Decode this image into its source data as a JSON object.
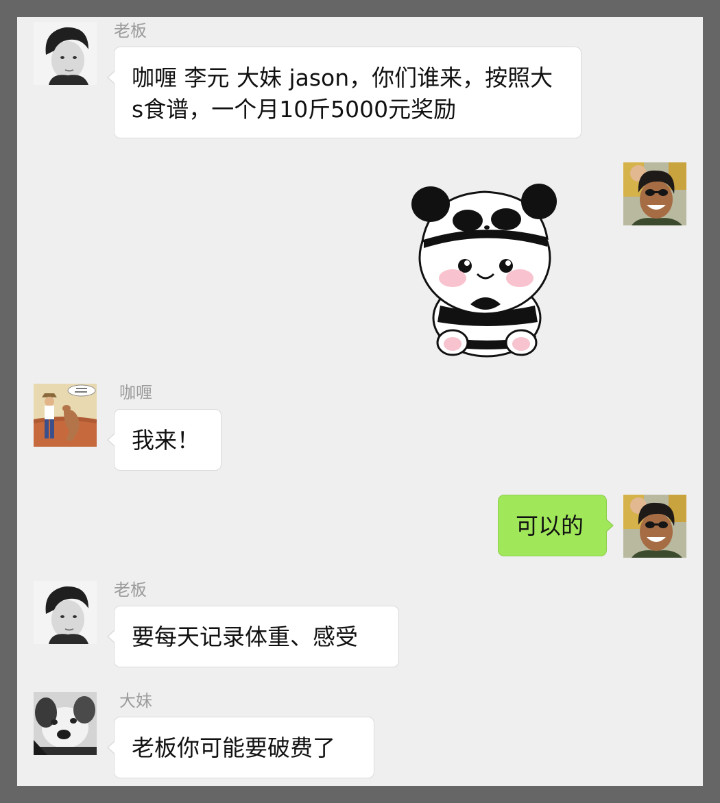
{
  "messages": [
    {
      "sender": "老板",
      "side": "left",
      "avatar": "young-man-bw-avatar",
      "text": "咖喱 李元 大妹 jason，你们谁来，按照大s食谱，一个月10斤5000元奖励"
    },
    {
      "sender": "self",
      "side": "right",
      "avatar": "laughing-man-sunglasses-avatar",
      "sticker": "panda-hat-bear-sticker"
    },
    {
      "sender": "咖喱",
      "side": "left",
      "avatar": "cartoon-kangaroo-avatar",
      "text": "我来！"
    },
    {
      "sender": "self",
      "side": "right",
      "avatar": "laughing-man-sunglasses-avatar",
      "text": "可以的"
    },
    {
      "sender": "老板",
      "side": "left",
      "avatar": "young-man-bw-avatar",
      "text": "要每天记录体重、感受"
    },
    {
      "sender": "大妹",
      "side": "left",
      "avatar": "puppy-bw-avatar",
      "text": "老板你可能要破费了"
    }
  ],
  "colors": {
    "frame": "#666666",
    "chat_background": "#efefef",
    "left_bubble": "#ffffff",
    "right_bubble": "#a0e75a",
    "name_text": "#9b9b9b"
  }
}
